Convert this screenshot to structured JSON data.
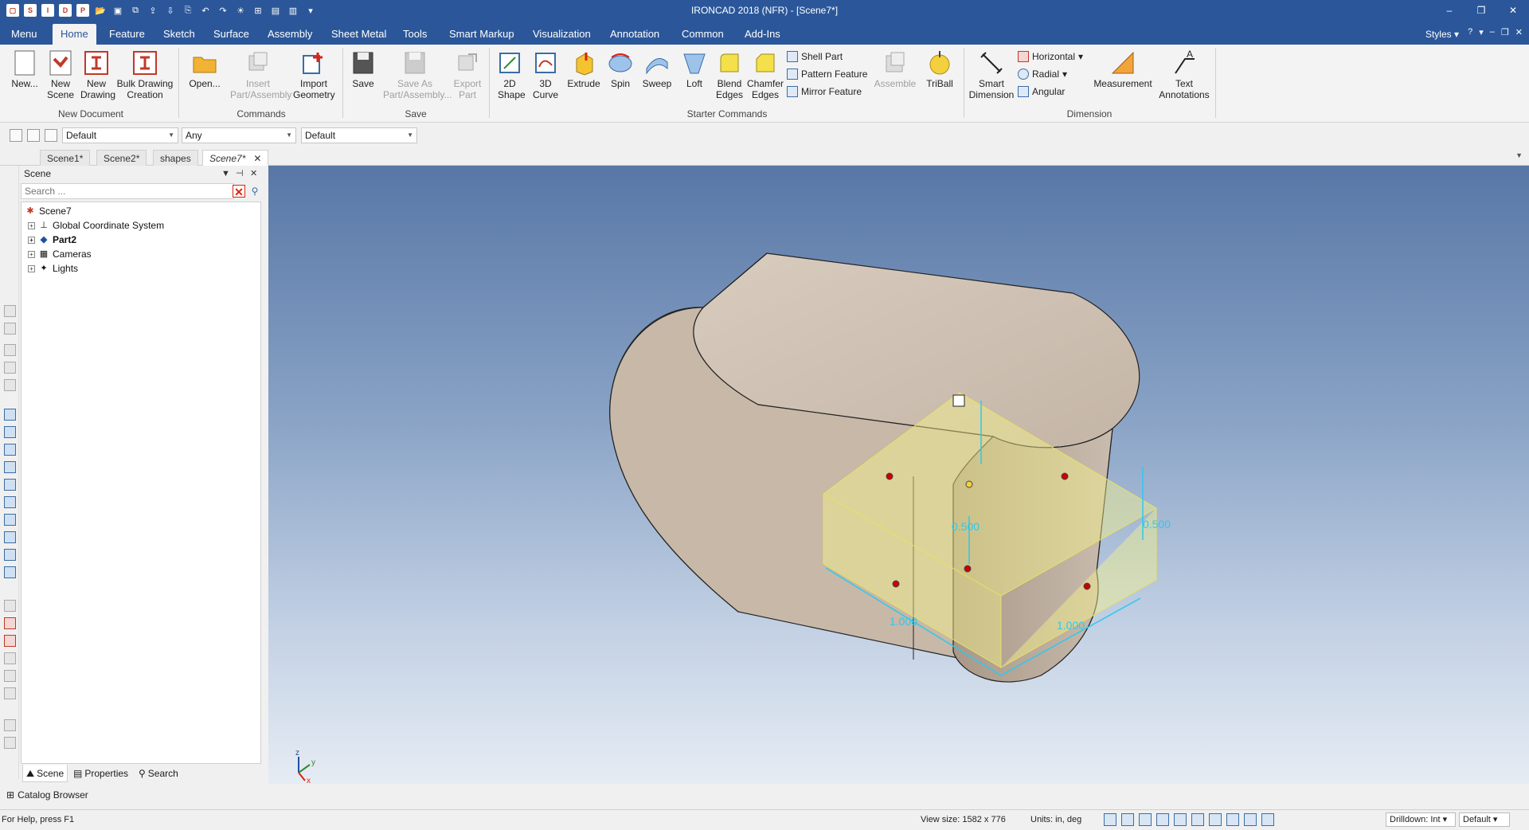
{
  "app": {
    "title": "IRONCAD 2018 (NFR) - [Scene7*]"
  },
  "window_controls": {
    "minimize": "–",
    "restore": "❐",
    "close": "✕"
  },
  "ribbon_tabs": [
    "Menu",
    "Home",
    "Feature",
    "Sketch",
    "Surface",
    "Assembly",
    "Sheet Metal",
    "Tools",
    "Smart Markup",
    "Visualization",
    "Annotation",
    "Common",
    "Add-Ins"
  ],
  "active_tab": "Home",
  "styles_label": "Styles",
  "ribbon": {
    "new_document": {
      "label": "New Document",
      "new": "New...",
      "new_scene": "New Scene",
      "new_drawing": "New Drawing",
      "bulk_drawing": "Bulk Drawing Creation"
    },
    "commands": {
      "label": "Commands",
      "open": "Open...",
      "insert_part": "Insert Part/Assembly",
      "import_geometry": "Import Geometry"
    },
    "save": {
      "label": "Save",
      "save": "Save",
      "save_as": "Save As Part/Assembly...",
      "export_part": "Export Part"
    },
    "starter": {
      "label": "Starter Commands",
      "shape2d": "2D Shape",
      "curve3d": "3D Curve",
      "extrude": "Extrude",
      "spin": "Spin",
      "sweep": "Sweep",
      "loft": "Loft",
      "blend": "Blend Edges",
      "chamfer": "Chamfer Edges",
      "shell": "Shell Part",
      "pattern": "Pattern Feature",
      "mirror": "Mirror Feature",
      "assemble": "Assemble",
      "triball": "TriBall"
    },
    "dimension": {
      "label": "Dimension",
      "smart": "Smart Dimension",
      "horizontal": "Horizontal",
      "radial": "Radial",
      "angular": "Angular",
      "measurement": "Measurement",
      "text_annotations": "Text Annotations"
    }
  },
  "selection_toolbar": {
    "combo1": "Default",
    "combo2": "Any",
    "combo3": "Default"
  },
  "doc_tabs": [
    "Scene1*",
    "Scene2*",
    "shapes",
    "Scene7*"
  ],
  "active_doc_tab": "Scene7*",
  "scene_panel": {
    "title": "Scene",
    "search_placeholder": "Search ...",
    "tree": [
      {
        "label": "Scene7",
        "level": 0
      },
      {
        "label": "Global Coordinate System",
        "level": 1
      },
      {
        "label": "Part2",
        "level": 1
      },
      {
        "label": "Cameras",
        "level": 1
      },
      {
        "label": "Lights",
        "level": 1
      }
    ],
    "bottom_tabs": [
      "Scene",
      "Properties",
      "Search"
    ]
  },
  "viewport": {
    "dim_height": "0.500",
    "dim_right": "0.500",
    "dim_length": "1.000",
    "dim_width": "1.000",
    "axis_z": "z",
    "axis_y": "y",
    "axis_x": "x",
    "colors": {
      "part": "#c8b8a8",
      "selection": "#f6f58a",
      "dimension": "#2fc8ee"
    }
  },
  "catalog_browser": "Catalog Browser",
  "status": {
    "help": "For Help, press F1",
    "view_size": "View size: 1582 x  776",
    "units": "Units: in, deg",
    "drilldown": "Drilldown: Int",
    "default": "Default"
  }
}
